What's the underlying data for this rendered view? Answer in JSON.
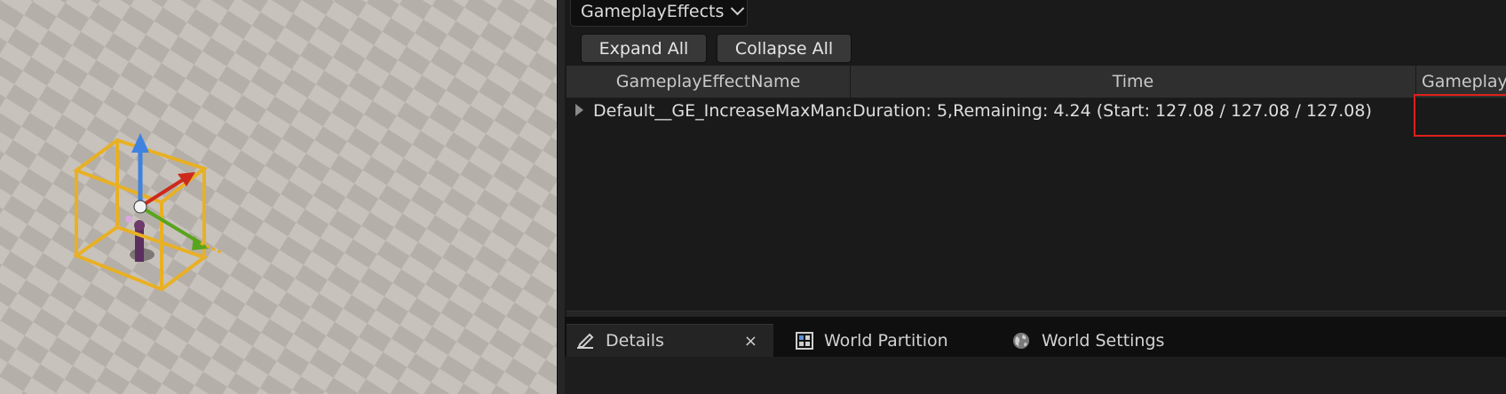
{
  "viewport": {
    "floor_light": "#c9c3bd",
    "floor_dark": "#b6b0aa",
    "gizmo_box_color": "#e8b024"
  },
  "panel": {
    "mode_dropdown": "GameplayEffects",
    "toolbar": {
      "expand_all": "Expand All",
      "collapse_all": "Collapse All"
    },
    "columns": [
      "GameplayEffectName",
      "Time",
      "GameplayE"
    ],
    "rows": [
      {
        "name": "Default__GE_IncreaseMaxMana_C",
        "time": "Duration: 5,Remaining: 4.24 (Start: 127.08 / 127.08 / 127.08)"
      }
    ],
    "highlight_color": "#e0201c"
  },
  "bottom_tabs": {
    "details": "Details",
    "close": "×",
    "world_partition": "World Partition",
    "world_settings": "World Settings"
  }
}
